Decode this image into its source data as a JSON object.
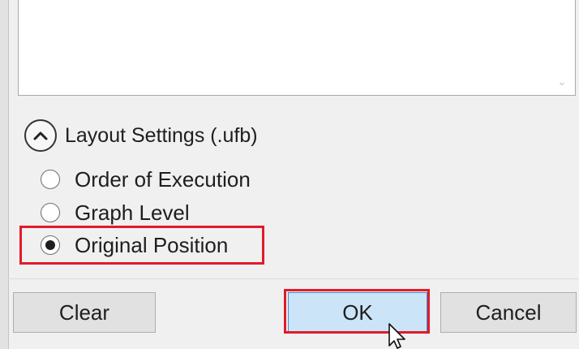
{
  "list_box": {
    "scroll_glyph": "⌄"
  },
  "layout_settings": {
    "title": "Layout Settings (.ufb)",
    "options": [
      {
        "label": "Order of Execution",
        "selected": false
      },
      {
        "label": "Graph Level",
        "selected": false
      },
      {
        "label": "Original Position",
        "selected": true
      }
    ]
  },
  "buttons": {
    "clear": "Clear",
    "ok": "OK",
    "cancel": "Cancel"
  },
  "icons": {
    "collapse": "chevron-up-icon",
    "pointer": "mouse-pointer-icon"
  },
  "colors": {
    "highlight": "#e11b2a",
    "ok_fill": "#cce4f7",
    "ok_border": "#3c8ed6",
    "button_fill": "#e1e1e1"
  }
}
